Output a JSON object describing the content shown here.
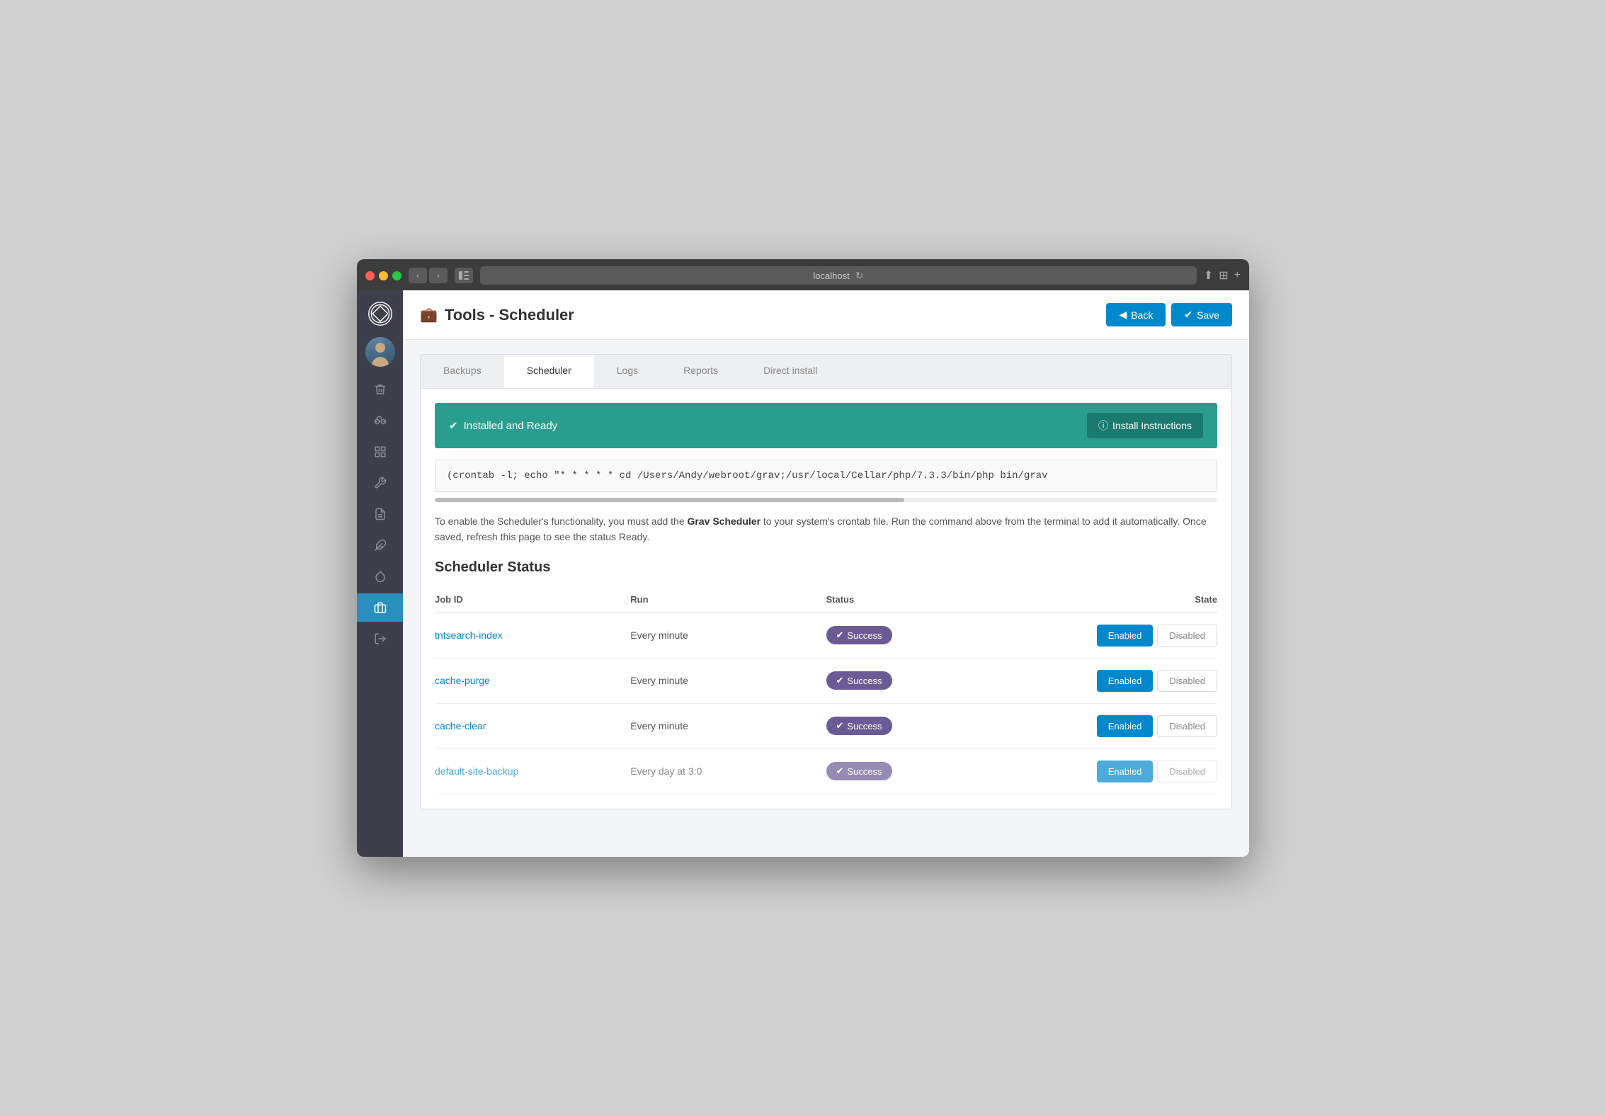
{
  "browser": {
    "url": "localhost",
    "back_icon": "◀",
    "forward_icon": "▶"
  },
  "header": {
    "icon": "💼",
    "title": "Tools - Scheduler",
    "back_label": "Back",
    "save_label": "Save"
  },
  "tabs": [
    {
      "id": "backups",
      "label": "Backups",
      "active": false
    },
    {
      "id": "scheduler",
      "label": "Scheduler",
      "active": true
    },
    {
      "id": "logs",
      "label": "Logs",
      "active": false
    },
    {
      "id": "reports",
      "label": "Reports",
      "active": false
    },
    {
      "id": "direct-install",
      "label": "Direct install",
      "active": false
    }
  ],
  "status_banner": {
    "check_icon": "✔",
    "text": "Installed and Ready",
    "info_icon": "ⓘ",
    "install_btn_label": "Install Instructions"
  },
  "command": {
    "text": "(crontab -l; echo \"* * * * * cd /Users/Andy/webroot/grav;/usr/local/Cellar/php/7.3.3/bin/php bin/grav"
  },
  "description": {
    "text_before": "To enable the Scheduler's functionality, you must add the ",
    "bold_text": "Grav Scheduler",
    "text_after": " to your system's crontab file. Run the command above from the terminal to add it automatically. Once saved, refresh this page to see the status Ready."
  },
  "scheduler_status": {
    "section_title": "Scheduler Status",
    "columns": {
      "job_id": "Job ID",
      "run": "Run",
      "status": "Status",
      "state": "State"
    },
    "rows": [
      {
        "job_id": "tntsearch-index",
        "run": "Every minute",
        "status": "Success",
        "enabled_label": "Enabled",
        "disabled_label": "Disabled",
        "state": "enabled"
      },
      {
        "job_id": "cache-purge",
        "run": "Every minute",
        "status": "Success",
        "enabled_label": "Enabled",
        "disabled_label": "Disabled",
        "state": "enabled"
      },
      {
        "job_id": "cache-clear",
        "run": "Every minute",
        "status": "Success",
        "enabled_label": "Enabled",
        "disabled_label": "Disabled",
        "state": "enabled"
      },
      {
        "job_id": "default-site-backup",
        "run": "Every day at 3:0",
        "status": "Success",
        "enabled_label": "Enabled",
        "disabled_label": "Disabled",
        "state": "enabled"
      }
    ]
  },
  "sidebar": {
    "items": [
      {
        "id": "trash",
        "icon": "🗑",
        "active": false
      },
      {
        "id": "binoculars",
        "icon": "🔭",
        "active": false
      },
      {
        "id": "grid",
        "icon": "⋮⋮",
        "active": false
      },
      {
        "id": "wrench",
        "icon": "🔧",
        "active": false
      },
      {
        "id": "file",
        "icon": "📄",
        "active": false
      },
      {
        "id": "tools",
        "icon": "⚙",
        "active": true
      },
      {
        "id": "drop",
        "icon": "💧",
        "active": false
      },
      {
        "id": "briefcase",
        "icon": "💼",
        "active": false
      },
      {
        "id": "logout",
        "icon": "↪",
        "active": false
      }
    ]
  }
}
